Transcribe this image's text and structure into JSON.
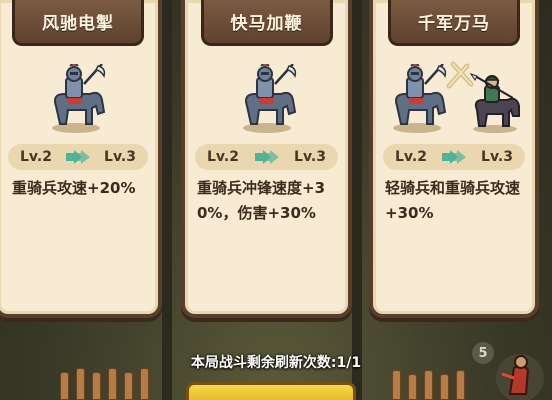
{
  "cards": [
    {
      "title": "风驰电掣",
      "level_from": "Lv.2",
      "level_to": "Lv.3",
      "description": "重骑兵攻速+20%",
      "units": [
        "heavy-cavalry-icon"
      ]
    },
    {
      "title": "快马加鞭",
      "level_from": "Lv.2",
      "level_to": "Lv.3",
      "description": "重骑兵冲锋速度+30%，伤害+30%",
      "units": [
        "heavy-cavalry-icon"
      ]
    },
    {
      "title": "千军万马",
      "level_from": "Lv.2",
      "level_to": "Lv.3",
      "description": "轻骑兵和重骑兵攻速+30%",
      "units": [
        "heavy-cavalry-icon",
        "light-cavalry-icon"
      ]
    }
  ],
  "footer": {
    "refresh_text": "本局战斗剩余刷新次数:1/1"
  },
  "round_badge": "5",
  "colors": {
    "card_bg": "#f7ecd3",
    "banner_bg": "#6b4c36",
    "level_bg": "#ead7b0",
    "arrow": "#4fb39a",
    "button": "#f0c030"
  }
}
